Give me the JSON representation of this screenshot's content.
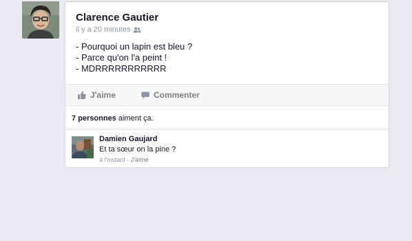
{
  "post": {
    "author": "Clarence Gautier",
    "time": "il y a 20 minutes",
    "privacy_icon": "friends-icon",
    "lines": [
      "- Pourquoi un lapin est bleu ?",
      "- Parce qu'on l'a peint !",
      "- MDRRRRRRRRRRR"
    ]
  },
  "actions": {
    "like_label": "J'aime",
    "like_icon": "thumbs-up-icon",
    "comment_label": "Commenter",
    "comment_icon": "speech-bubble-icon"
  },
  "likes": {
    "count_text": "7 personnes",
    "suffix": " aiment ça."
  },
  "comment": {
    "author": "Damien Gaujard",
    "text": "Et ta sœur on la pine ?",
    "time": "à l'instant",
    "separator": " · ",
    "like_label": "J'aime"
  },
  "colors": {
    "background": "#e9eaed",
    "card": "#ffffff",
    "muted": "#9197a3",
    "text": "#141823"
  }
}
